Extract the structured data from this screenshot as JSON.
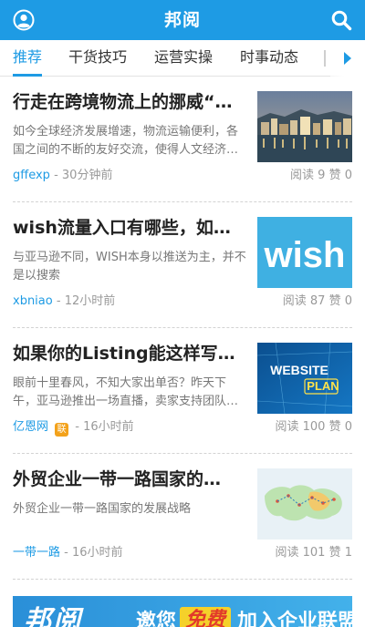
{
  "header": {
    "title": "邦阅",
    "left_icon": "user-profile-icon",
    "right_icon": "search-icon",
    "color": "#1e9be4"
  },
  "tabs": [
    {
      "label": "推荐",
      "active": true
    },
    {
      "label": "干货技巧",
      "active": false
    },
    {
      "label": "运营实操",
      "active": false
    },
    {
      "label": "时事动态",
      "active": false
    }
  ],
  "articles": [
    {
      "title": "行走在跨境物流上的挪威“…",
      "summary": "如今全球经济发展增速，物流运输便利，各国之间的不断的友好交流，使得人文经济…",
      "author": "gffexp",
      "badge": "",
      "time": "30分钟前",
      "reads": "阅读 9",
      "likes": "赞 0",
      "thumb": "harbor-town-photo"
    },
    {
      "title": "wish流量入口有哪些，如…",
      "summary": "与亚马逊不同，WISH本身以推送为主，并不是以搜索",
      "author": "xbniao",
      "badge": "",
      "time": "12小时前",
      "reads": "阅读 87",
      "likes": "赞 0",
      "thumb": "wish-logo-image",
      "thumb_text": "wish"
    },
    {
      "title": "如果你的Listing能这样写…",
      "summary": "眼前十里春风，不知大家出单否？昨天下午，亚马逊推出一场直播，卖家支持团队…",
      "author": "亿恩网",
      "badge": "联",
      "time": "16小时前",
      "reads": "阅读 100",
      "likes": "赞 0",
      "thumb": "website-plan-image",
      "thumb_text": "WEBSITE",
      "thumb_text2": "PLAN"
    },
    {
      "title": "外贸企业一带一路国家的…",
      "summary": "外贸企业一带一路国家的发展战略",
      "author": "一带一路",
      "badge": "",
      "time": "16小时前",
      "reads": "阅读 101",
      "likes": "赞 1",
      "thumb": "belt-road-map-image"
    }
  ],
  "banner": {
    "logo": "邦阅",
    "text1": "邀您",
    "free": "免费",
    "text2": "加入企业联盟"
  }
}
